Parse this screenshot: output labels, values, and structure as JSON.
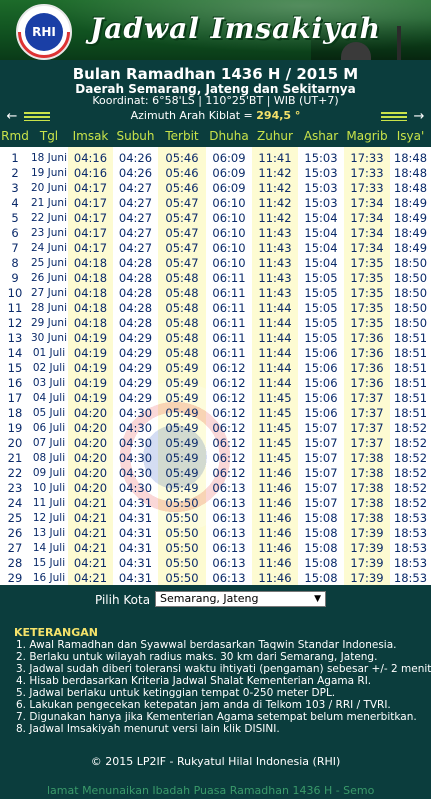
{
  "app": {
    "title": "Jadwal Imsakiyah",
    "logo_text": "RHI",
    "colors": {
      "accent": "#c9e34a",
      "background": "#0b3d3d",
      "highlight": "#f5e26a"
    }
  },
  "header": {
    "month": "Bulan Ramadhan 1436 H / 2015 M",
    "region": "Daerah Semarang, Jateng dan Sekitarnya",
    "coord": "Koordinat: 6°58'LS | 110°25'BT | WIB (UT+7)"
  },
  "nav": {
    "prev_icon": "left-arrow-icon",
    "next_icon": "right-arrow-icon",
    "azimuth_label": "Azimuth Arah Kiblat =",
    "azimuth_value": "294,5 °"
  },
  "table": {
    "columns": [
      "Rmd",
      "Tgl",
      "Imsak",
      "Subuh",
      "Terbit",
      "Dhuha",
      "Zuhur",
      "Ashar",
      "Magrib",
      "Isya'"
    ],
    "rows": [
      [
        "1",
        "18 Juni",
        "04:16",
        "04:26",
        "05:46",
        "06:09",
        "11:41",
        "15:03",
        "17:33",
        "18:48"
      ],
      [
        "2",
        "19 Juni",
        "04:16",
        "04:26",
        "05:46",
        "06:09",
        "11:42",
        "15:03",
        "17:33",
        "18:48"
      ],
      [
        "3",
        "20 Juni",
        "04:17",
        "04:27",
        "05:46",
        "06:09",
        "11:42",
        "15:03",
        "17:33",
        "18:48"
      ],
      [
        "4",
        "21 Juni",
        "04:17",
        "04:27",
        "05:47",
        "06:10",
        "11:42",
        "15:03",
        "17:34",
        "18:49"
      ],
      [
        "5",
        "22 Juni",
        "04:17",
        "04:27",
        "05:47",
        "06:10",
        "11:42",
        "15:04",
        "17:34",
        "18:49"
      ],
      [
        "6",
        "23 Juni",
        "04:17",
        "04:27",
        "05:47",
        "06:10",
        "11:43",
        "15:04",
        "17:34",
        "18:49"
      ],
      [
        "7",
        "24 Juni",
        "04:17",
        "04:27",
        "05:47",
        "06:10",
        "11:43",
        "15:04",
        "17:34",
        "18:49"
      ],
      [
        "8",
        "25 Juni",
        "04:18",
        "04:28",
        "05:47",
        "06:10",
        "11:43",
        "15:04",
        "17:35",
        "18:50"
      ],
      [
        "9",
        "26 Juni",
        "04:18",
        "04:28",
        "05:48",
        "06:11",
        "11:43",
        "15:05",
        "17:35",
        "18:50"
      ],
      [
        "10",
        "27 Juni",
        "04:18",
        "04:28",
        "05:48",
        "06:11",
        "11:43",
        "15:05",
        "17:35",
        "18:50"
      ],
      [
        "11",
        "28 Juni",
        "04:18",
        "04:28",
        "05:48",
        "06:11",
        "11:44",
        "15:05",
        "17:35",
        "18:50"
      ],
      [
        "12",
        "29 Juni",
        "04:18",
        "04:28",
        "05:48",
        "06:11",
        "11:44",
        "15:05",
        "17:35",
        "18:50"
      ],
      [
        "13",
        "30 Juni",
        "04:19",
        "04:29",
        "05:48",
        "06:11",
        "11:44",
        "15:05",
        "17:36",
        "18:51"
      ],
      [
        "14",
        "01 Juli",
        "04:19",
        "04:29",
        "05:48",
        "06:11",
        "11:44",
        "15:06",
        "17:36",
        "18:51"
      ],
      [
        "15",
        "02 Juli",
        "04:19",
        "04:29",
        "05:49",
        "06:12",
        "11:44",
        "15:06",
        "17:36",
        "18:51"
      ],
      [
        "16",
        "03 Juli",
        "04:19",
        "04:29",
        "05:49",
        "06:12",
        "11:44",
        "15:06",
        "17:36",
        "18:51"
      ],
      [
        "17",
        "04 Juli",
        "04:19",
        "04:29",
        "05:49",
        "06:12",
        "11:45",
        "15:06",
        "17:37",
        "18:51"
      ],
      [
        "18",
        "05 Juli",
        "04:20",
        "04:30",
        "05:49",
        "06:12",
        "11:45",
        "15:06",
        "17:37",
        "18:51"
      ],
      [
        "19",
        "06 Juli",
        "04:20",
        "04:30",
        "05:49",
        "06:12",
        "11:45",
        "15:07",
        "17:37",
        "18:52"
      ],
      [
        "20",
        "07 Juli",
        "04:20",
        "04:30",
        "05:49",
        "06:12",
        "11:45",
        "15:07",
        "17:37",
        "18:52"
      ],
      [
        "21",
        "08 Juli",
        "04:20",
        "04:30",
        "05:49",
        "06:12",
        "11:45",
        "15:07",
        "17:38",
        "18:52"
      ],
      [
        "22",
        "09 Juli",
        "04:20",
        "04:30",
        "05:49",
        "06:12",
        "11:46",
        "15:07",
        "17:38",
        "18:52"
      ],
      [
        "23",
        "10 Juli",
        "04:20",
        "04:30",
        "05:49",
        "06:13",
        "11:46",
        "15:07",
        "17:38",
        "18:52"
      ],
      [
        "24",
        "11 Juli",
        "04:21",
        "04:31",
        "05:50",
        "06:13",
        "11:46",
        "15:07",
        "17:38",
        "18:52"
      ],
      [
        "25",
        "12 Juli",
        "04:21",
        "04:31",
        "05:50",
        "06:13",
        "11:46",
        "15:08",
        "17:38",
        "18:53"
      ],
      [
        "26",
        "13 Juli",
        "04:21",
        "04:31",
        "05:50",
        "06:13",
        "11:46",
        "15:08",
        "17:39",
        "18:53"
      ],
      [
        "27",
        "14 Juli",
        "04:21",
        "04:31",
        "05:50",
        "06:13",
        "11:46",
        "15:08",
        "17:39",
        "18:53"
      ],
      [
        "28",
        "15 Juli",
        "04:21",
        "04:31",
        "05:50",
        "06:13",
        "11:46",
        "15:08",
        "17:39",
        "18:53"
      ],
      [
        "29",
        "16 Juli",
        "04:21",
        "04:31",
        "05:50",
        "06:13",
        "11:46",
        "15:08",
        "17:39",
        "18:53"
      ]
    ]
  },
  "filter": {
    "label": "Pilih Kota",
    "selected": "Semarang, Jateng"
  },
  "notes": {
    "title": "KETERANGAN",
    "items": [
      "1. Awal Ramadhan dan Syawwal berdasarkan Taqwin Standar Indonesia.",
      "2. Berlaku untuk wilayah radius maks. 30 km dari Semarang, Jateng.",
      "3. Jadwal sudah diberi toleransi waktu ihtiyati (pengaman) sebesar +/- 2 menit.",
      "4. Hisab berdasarkan Kriteria Jadwal Shalat Kementerian Agama RI.",
      "5. Jadwal berlaku untuk ketinggian tempat 0-250 meter DPL.",
      "6. Lakukan pengecekan ketepatan jam anda di Telkom 103 / RRI / TVRI.",
      "7. Digunakan hanya jika Kementerian Agama setempat belum menerbitkan.",
      "8. Jadwal Imsakiyah menurut versi lain klik DISINI."
    ]
  },
  "footer": {
    "copyright": "© 2015 LP2IF - Rukyatul Hilal Indonesia (RHI)",
    "ticker": "lamat Menunaikan Ibadah Puasa Ramadhan 1436 H - Semo"
  }
}
